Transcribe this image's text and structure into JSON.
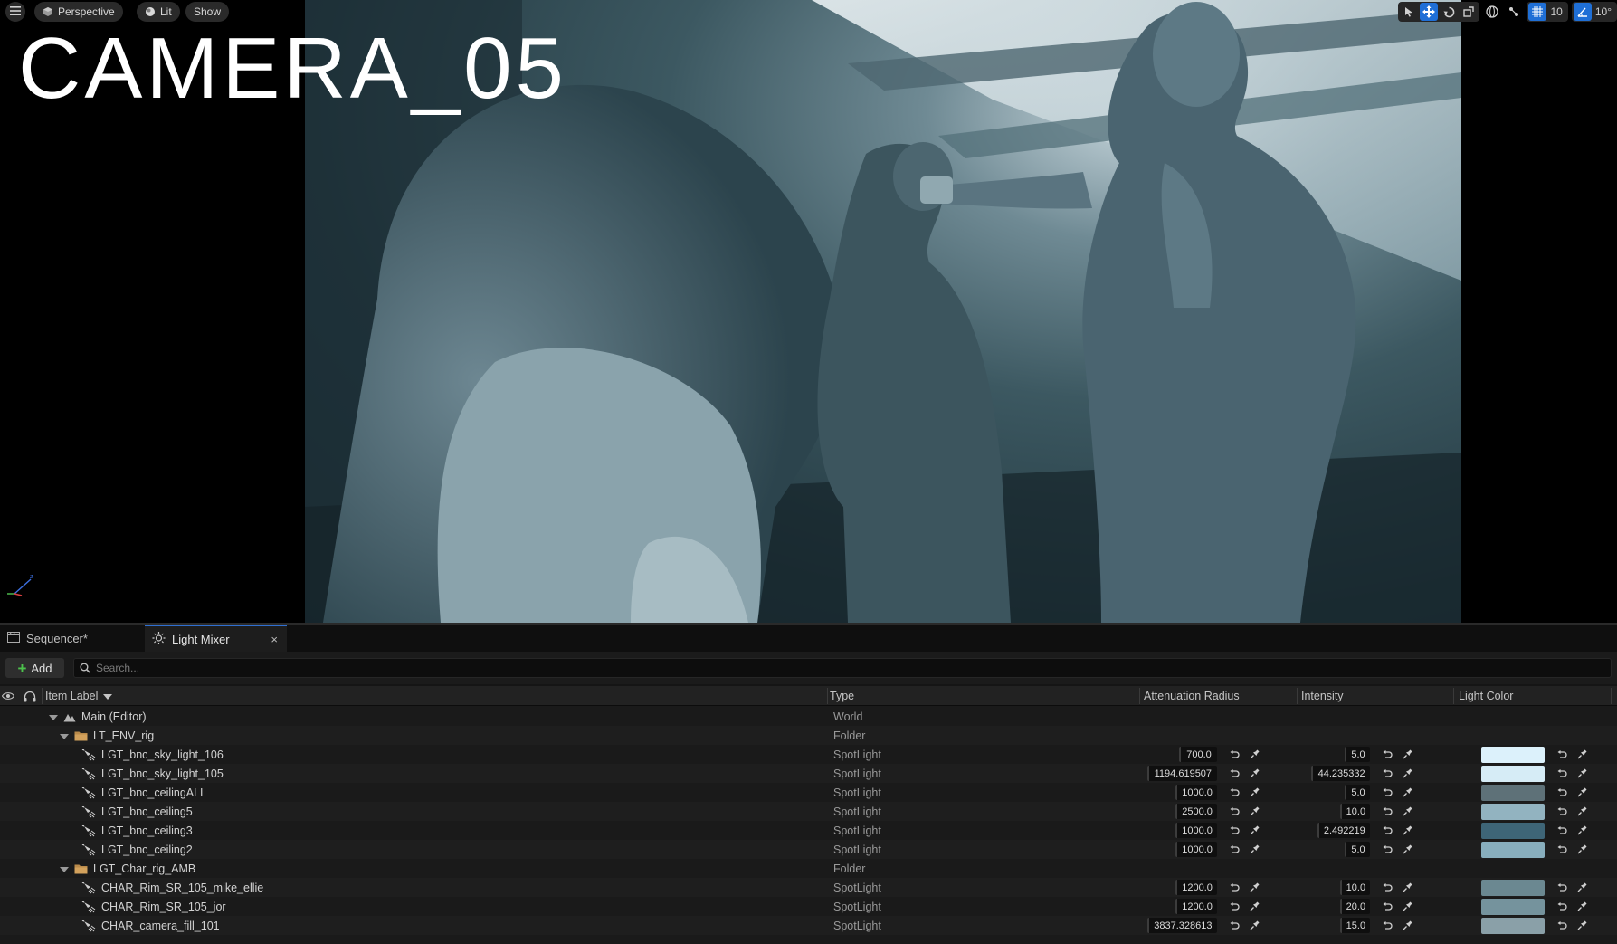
{
  "viewport": {
    "camera_title": "CAMERA_05",
    "perspective_label": "Perspective",
    "lit_label": "Lit",
    "show_label": "Show",
    "grid_snap_value": "10",
    "rotation_snap_value": "10°"
  },
  "tabs": {
    "sequencer": "Sequencer*",
    "light_mixer": "Light Mixer",
    "close": "×"
  },
  "toolbar": {
    "add_label": "Add",
    "search_placeholder": "Search..."
  },
  "table": {
    "headers": {
      "item_label": "Item Label",
      "type": "Type",
      "attenuation_radius": "Attenuation Radius",
      "intensity": "Intensity",
      "light_color": "Light Color"
    },
    "rows": [
      {
        "label": "Main (Editor)",
        "type": "World",
        "kind": "world"
      },
      {
        "label": "LT_ENV_rig",
        "type": "Folder",
        "kind": "folder"
      },
      {
        "label": "LGT_bnc_sky_light_106",
        "type": "SpotLight",
        "kind": "light",
        "attenuation": "700.0",
        "intensity": "5.0",
        "color": "#dcf1fb"
      },
      {
        "label": "LGT_bnc_sky_light_105",
        "type": "SpotLight",
        "kind": "light",
        "attenuation": "1194.619507",
        "intensity": "44.235332",
        "color": "#d6ecf6"
      },
      {
        "label": "LGT_bnc_ceilingALL",
        "type": "SpotLight",
        "kind": "light",
        "attenuation": "1000.0",
        "intensity": "5.0",
        "color": "#5e7178"
      },
      {
        "label": "LGT_bnc_ceiling5",
        "type": "SpotLight",
        "kind": "light",
        "attenuation": "2500.0",
        "intensity": "10.0",
        "color": "#92b3c0"
      },
      {
        "label": "LGT_bnc_ceiling3",
        "type": "SpotLight",
        "kind": "light",
        "attenuation": "1000.0",
        "intensity": "2.492219",
        "color": "#3e6577"
      },
      {
        "label": "LGT_bnc_ceiling2",
        "type": "SpotLight",
        "kind": "light",
        "attenuation": "1000.0",
        "intensity": "5.0",
        "color": "#88aebd"
      },
      {
        "label": "LGT_Char_rig_AMB",
        "type": "Folder",
        "kind": "folder"
      },
      {
        "label": "CHAR_Rim_SR_105_mike_ellie",
        "type": "SpotLight",
        "kind": "light",
        "attenuation": "1200.0",
        "intensity": "10.0",
        "color": "#6b8891"
      },
      {
        "label": "CHAR_Rim_SR_105_jor",
        "type": "SpotLight",
        "kind": "light",
        "attenuation": "1200.0",
        "intensity": "20.0",
        "color": "#75939d"
      },
      {
        "label": "CHAR_camera_fill_101",
        "type": "SpotLight",
        "kind": "light",
        "attenuation": "3837.328613",
        "intensity": "15.0",
        "color": "#8aa0a8"
      }
    ]
  },
  "icons": {
    "menu": "menu-icon",
    "perspective": "cube-icon",
    "lit": "lit-sphere-icon",
    "eye": "eye-icon",
    "headphones": "headphones-icon",
    "search": "search-icon",
    "reset": "reset-arrow-icon",
    "pin": "pin-icon"
  }
}
